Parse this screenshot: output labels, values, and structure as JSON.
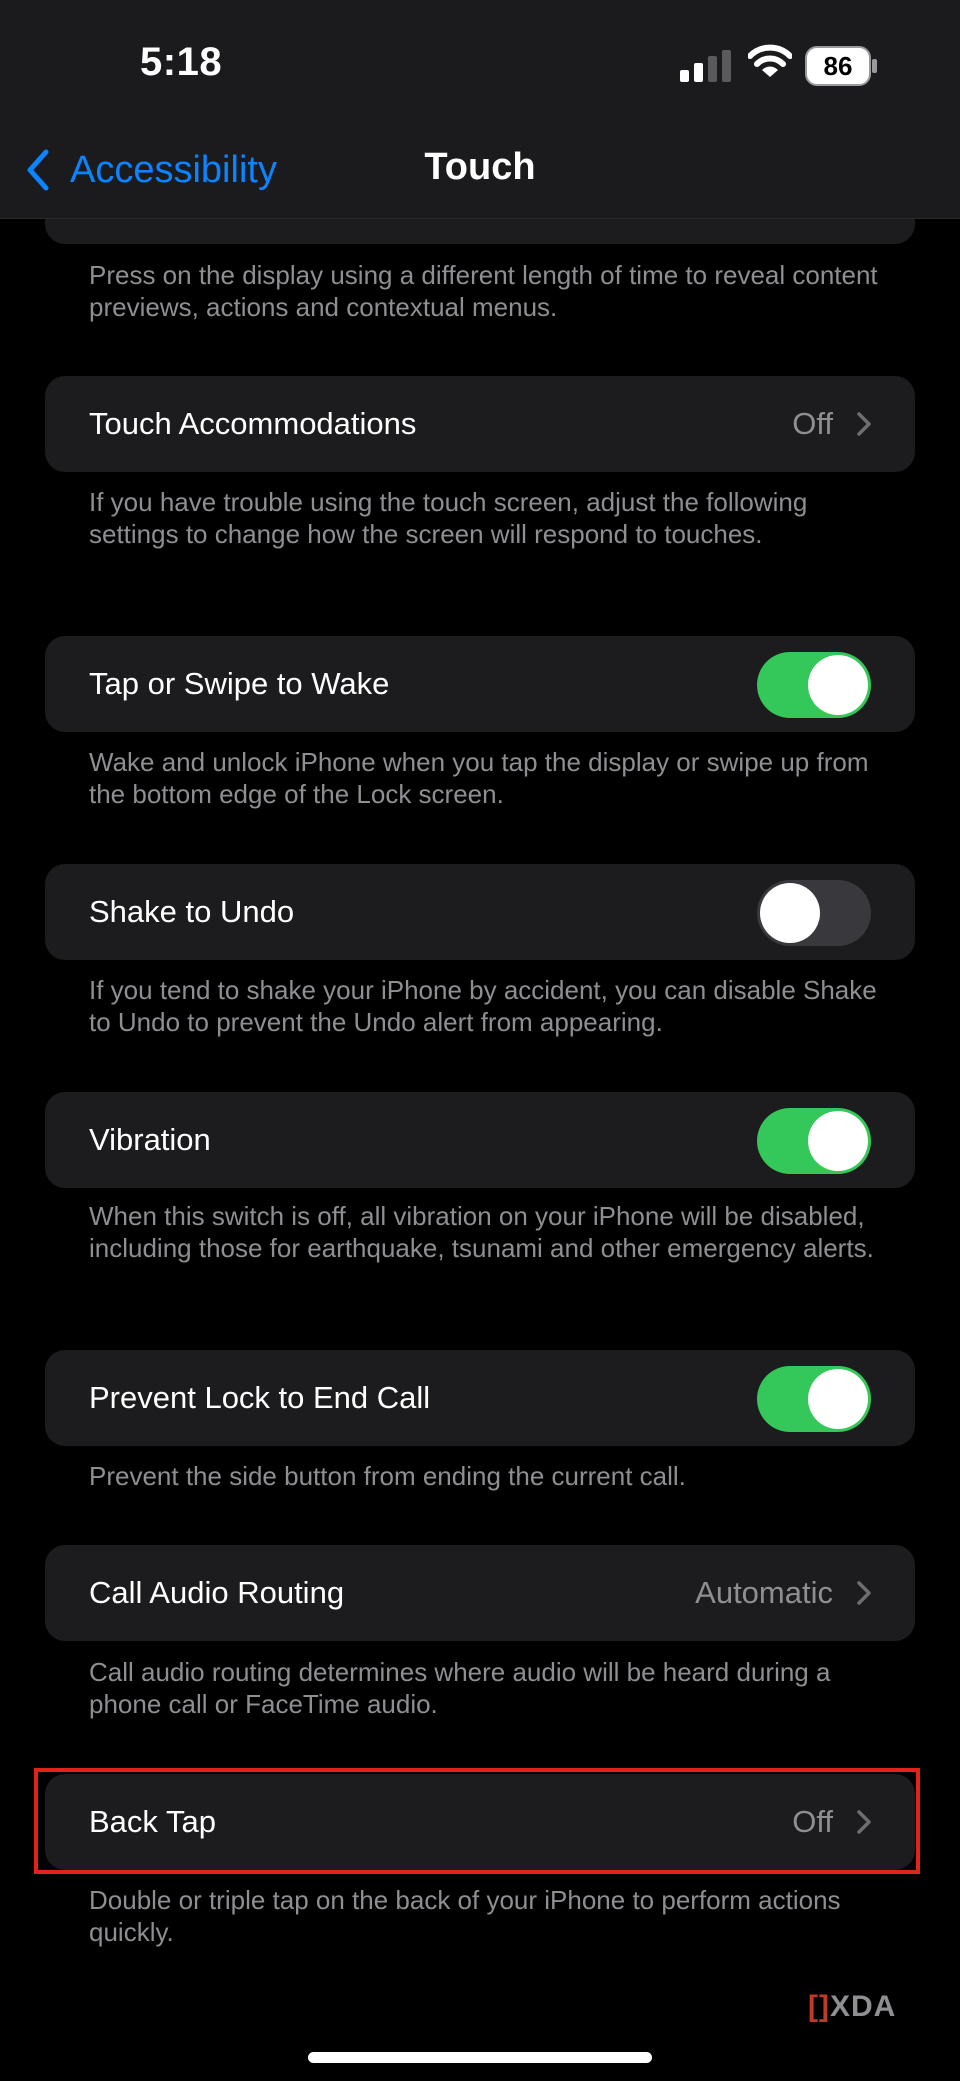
{
  "status_bar": {
    "time": "5:18",
    "battery": "86",
    "icons": [
      "signal-icon",
      "wifi-icon",
      "battery-icon"
    ]
  },
  "nav": {
    "back_label": "Accessibility",
    "title": "Touch"
  },
  "sections": {
    "haptic_touch": {
      "description": "Press on the display using a different length of time to reveal content previews, actions and contextual menus."
    },
    "touch_accommodations": {
      "label": "Touch Accommodations",
      "value": "Off",
      "description": "If you have trouble using the touch screen, adjust the following settings to change how the screen will respond to touches."
    },
    "tap_to_wake": {
      "label": "Tap or Swipe to Wake",
      "on": true,
      "description": "Wake and unlock iPhone when you tap the display or swipe up from the bottom edge of the Lock screen."
    },
    "shake_to_undo": {
      "label": "Shake to Undo",
      "on": false,
      "description": "If you tend to shake your iPhone by accident, you can disable Shake to Undo to prevent the Undo alert from appearing."
    },
    "vibration": {
      "label": "Vibration",
      "on": true,
      "description": "When this switch is off, all vibration on your iPhone will be disabled, including those for earthquake, tsunami and other emergency alerts."
    },
    "prevent_lock": {
      "label": "Prevent Lock to End Call",
      "on": true,
      "description": "Prevent the side button from ending the current call."
    },
    "call_audio_routing": {
      "label": "Call Audio Routing",
      "value": "Automatic",
      "description": "Call audio routing determines where audio will be heard during a phone call or FaceTime audio."
    },
    "back_tap": {
      "label": "Back Tap",
      "value": "Off",
      "description": "Double or triple tap on the back of your iPhone to perform actions quickly."
    }
  },
  "colors": {
    "accent": "#0a84ff",
    "toggle_on": "#34c759",
    "highlight": "#e0241a"
  },
  "watermark": "XDA"
}
